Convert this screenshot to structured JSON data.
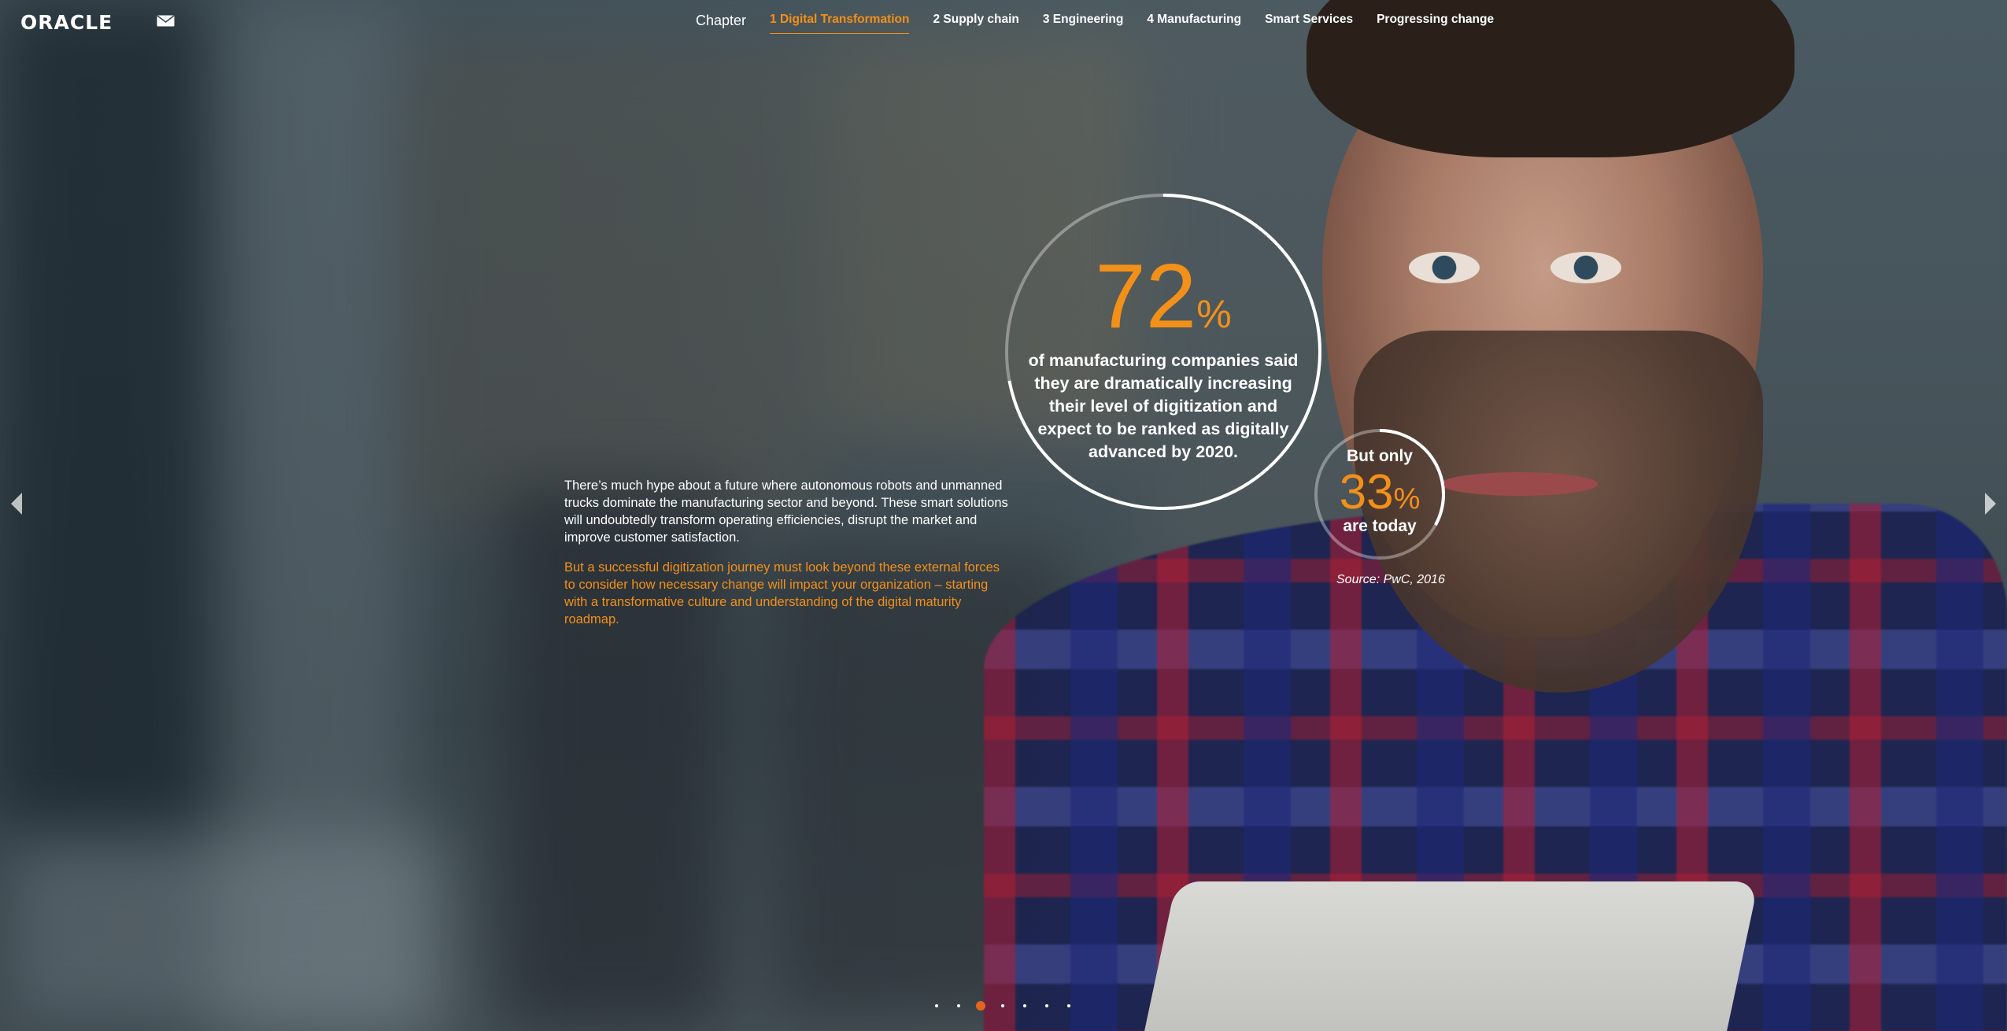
{
  "header": {
    "logo": "ORACLE",
    "mail_icon": "mail-icon",
    "nav": {
      "chapter_label": "Chapter",
      "items": [
        {
          "label": "1 Digital Transformation",
          "active": true
        },
        {
          "label": "2 Supply chain",
          "active": false
        },
        {
          "label": "3 Engineering",
          "active": false
        },
        {
          "label": "4 Manufacturing",
          "active": false
        },
        {
          "label": "Smart Services",
          "active": false
        },
        {
          "label": "Progressing change",
          "active": false
        }
      ]
    }
  },
  "stats": {
    "primary": {
      "value": "72",
      "unit": "%",
      "text": "of manufacturing companies said they are dramatically increasing their level of digitization and expect to be ranked as digitally advanced by 2020.",
      "ring_fraction": 0.72
    },
    "secondary": {
      "top": "But only",
      "value": "33",
      "unit": "%",
      "bottom": "are today",
      "ring_fraction": 0.33
    },
    "source": "Source: PwC, 2016"
  },
  "copy": {
    "paragraph_1": "There’s much hype about a future where autonomous robots and unmanned trucks dominate the manufacturing sector and beyond. These smart solutions will undoubtedly transform operating efficiencies, disrupt the market and improve customer satisfaction.",
    "paragraph_2": "But a successful digitization journey must look beyond these external forces to consider how necessary change will impact your organization – starting with a transformative culture and understanding of the digital maturity roadmap."
  },
  "navigation": {
    "prev_icon": "chevron-left-icon",
    "next_icon": "chevron-right-icon"
  },
  "pagination": {
    "total": 7,
    "current": 3
  },
  "colors": {
    "accent": "#f39019",
    "active_dot": "#e4651d",
    "text": "#ffffff"
  }
}
